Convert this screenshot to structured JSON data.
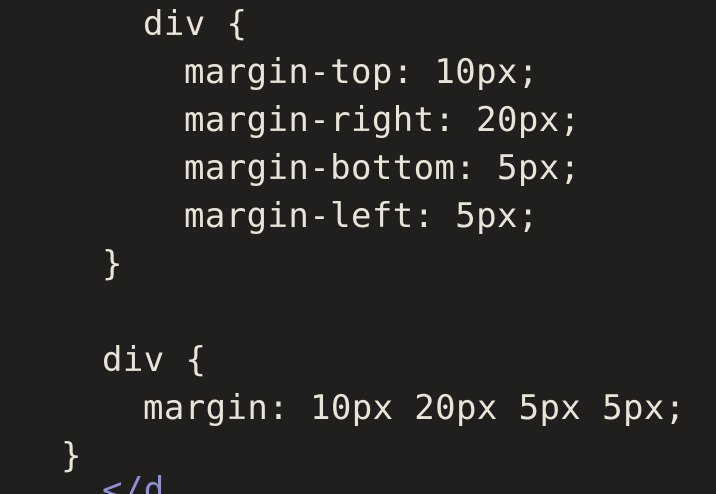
{
  "editor": {
    "theme": {
      "background": "#211f1e",
      "text": "#e9e4d7",
      "tag": "#8f8fd6"
    },
    "lines": [
      "div {",
      "margin-top: 10px;",
      "margin-right: 20px;",
      "margin-bottom: 5px;",
      "margin-left: 5px;",
      "}",
      "div {",
      "margin: 10px 20px 5px 5px;",
      "}",
      "</d"
    ]
  }
}
